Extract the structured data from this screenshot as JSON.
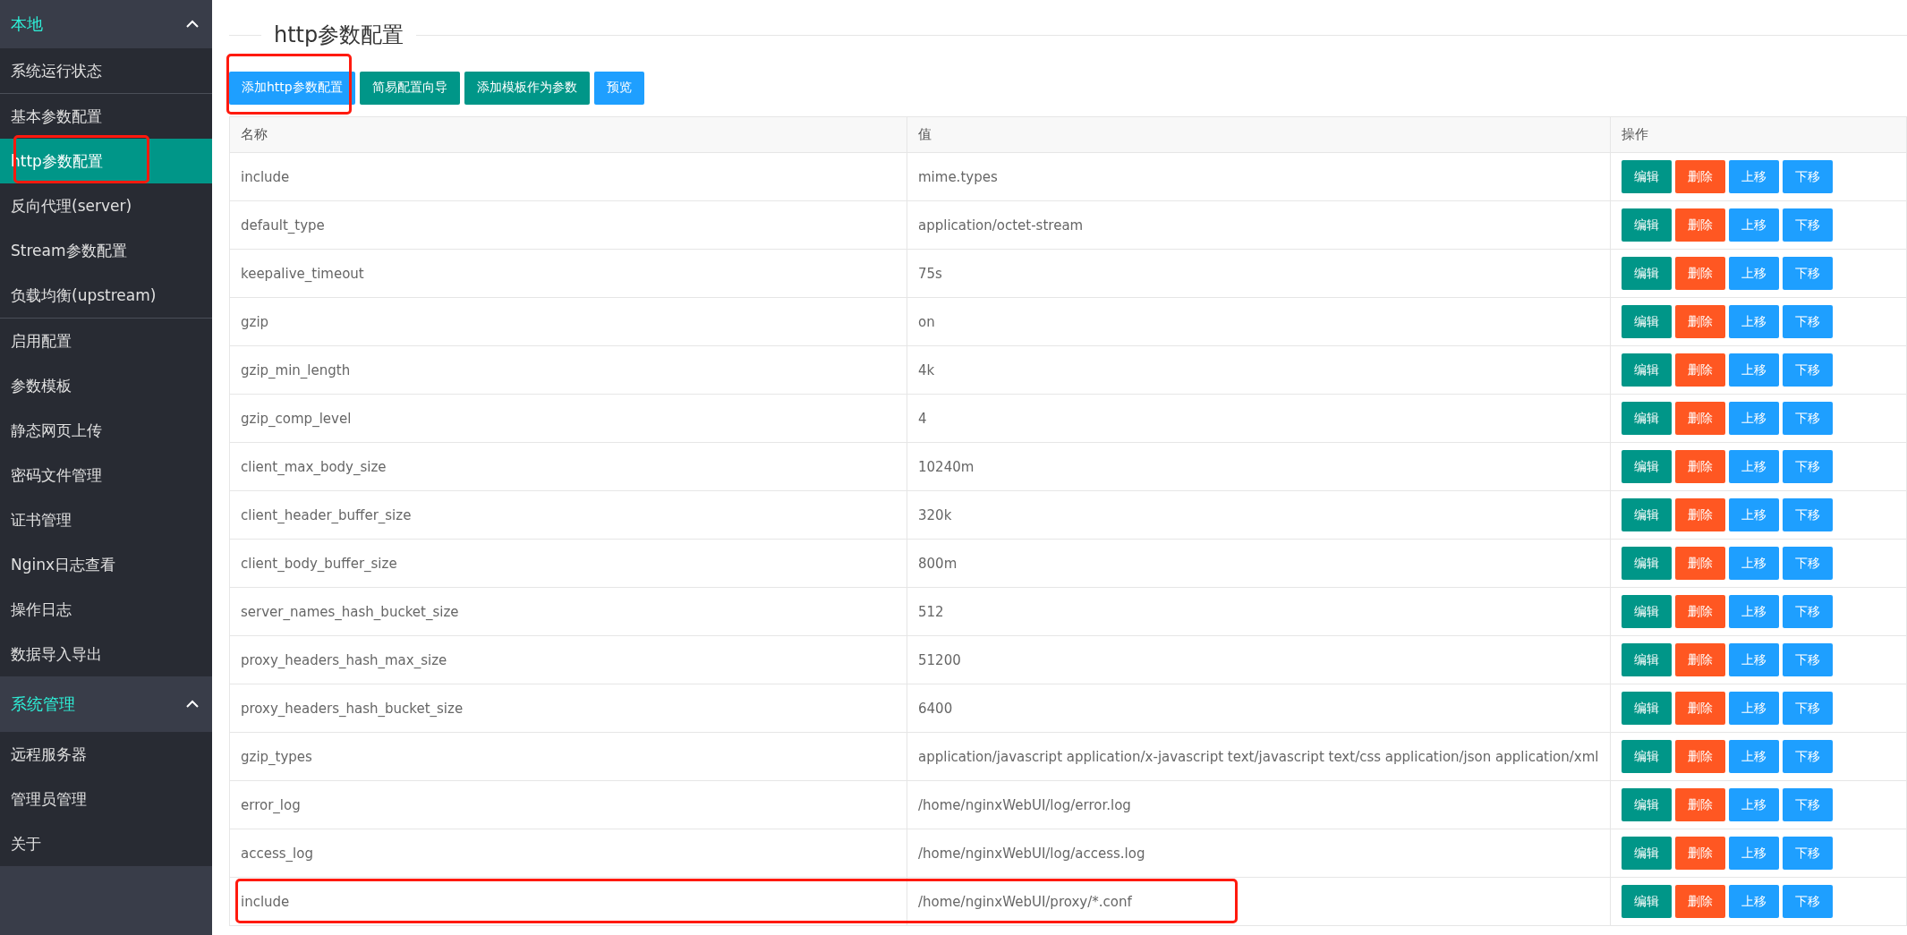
{
  "sidebar": {
    "groups": [
      {
        "title": "本地",
        "expanded": true,
        "sections": [
          [
            {
              "label": "系统运行状态",
              "selected": false,
              "highlighted": false
            }
          ],
          [
            {
              "label": "基本参数配置",
              "selected": false,
              "highlighted": false
            },
            {
              "label": "http参数配置",
              "selected": true,
              "highlighted": true
            },
            {
              "label": "反向代理(server)",
              "selected": false,
              "highlighted": false
            },
            {
              "label": "Stream参数配置",
              "selected": false,
              "highlighted": false
            },
            {
              "label": "负载均衡(upstream)",
              "selected": false,
              "highlighted": false
            }
          ],
          [
            {
              "label": "启用配置",
              "selected": false,
              "highlighted": false
            },
            {
              "label": "参数模板",
              "selected": false,
              "highlighted": false
            },
            {
              "label": "静态网页上传",
              "selected": false,
              "highlighted": false
            },
            {
              "label": "密码文件管理",
              "selected": false,
              "highlighted": false
            },
            {
              "label": "证书管理",
              "selected": false,
              "highlighted": false
            },
            {
              "label": "Nginx日志查看",
              "selected": false,
              "highlighted": false
            },
            {
              "label": "操作日志",
              "selected": false,
              "highlighted": false
            },
            {
              "label": "数据导入导出",
              "selected": false,
              "highlighted": false
            }
          ]
        ]
      },
      {
        "title": "系统管理",
        "expanded": true,
        "sections": [
          [
            {
              "label": "远程服务器",
              "selected": false,
              "highlighted": false
            },
            {
              "label": "管理员管理",
              "selected": false,
              "highlighted": false
            },
            {
              "label": "关于",
              "selected": false,
              "highlighted": false
            }
          ]
        ]
      }
    ]
  },
  "page_title": "http参数配置",
  "toolbar": [
    {
      "label": "添加http参数配置",
      "kind": "primary",
      "highlighted": true
    },
    {
      "label": "简易配置向导",
      "kind": "teal",
      "highlighted": false
    },
    {
      "label": "添加模板作为参数",
      "kind": "teal",
      "highlighted": false
    },
    {
      "label": "预览",
      "kind": "primary",
      "highlighted": false
    }
  ],
  "table": {
    "columns": [
      "名称",
      "值",
      "操作"
    ],
    "rows": [
      {
        "name": "include",
        "value": "mime.types",
        "highlighted": false,
        "actions": [
          {
            "label": "编辑",
            "kind": "teal"
          },
          {
            "label": "删除",
            "kind": "danger"
          },
          {
            "label": "上移",
            "kind": "primary"
          },
          {
            "label": "下移",
            "kind": "primary"
          }
        ]
      },
      {
        "name": "default_type",
        "value": "application/octet-stream",
        "highlighted": false,
        "actions": [
          {
            "label": "编辑",
            "kind": "teal"
          },
          {
            "label": "删除",
            "kind": "danger"
          },
          {
            "label": "上移",
            "kind": "primary"
          },
          {
            "label": "下移",
            "kind": "primary"
          }
        ]
      },
      {
        "name": "keepalive_timeout",
        "value": "75s",
        "highlighted": false,
        "actions": [
          {
            "label": "编辑",
            "kind": "teal"
          },
          {
            "label": "删除",
            "kind": "danger"
          },
          {
            "label": "上移",
            "kind": "primary"
          },
          {
            "label": "下移",
            "kind": "primary"
          }
        ]
      },
      {
        "name": "gzip",
        "value": "on",
        "highlighted": false,
        "actions": [
          {
            "label": "编辑",
            "kind": "teal"
          },
          {
            "label": "删除",
            "kind": "danger"
          },
          {
            "label": "上移",
            "kind": "primary"
          },
          {
            "label": "下移",
            "kind": "primary"
          }
        ]
      },
      {
        "name": "gzip_min_length",
        "value": "4k",
        "highlighted": false,
        "actions": [
          {
            "label": "编辑",
            "kind": "teal"
          },
          {
            "label": "删除",
            "kind": "danger"
          },
          {
            "label": "上移",
            "kind": "primary"
          },
          {
            "label": "下移",
            "kind": "primary"
          }
        ]
      },
      {
        "name": "gzip_comp_level",
        "value": "4",
        "highlighted": false,
        "actions": [
          {
            "label": "编辑",
            "kind": "teal"
          },
          {
            "label": "删除",
            "kind": "danger"
          },
          {
            "label": "上移",
            "kind": "primary"
          },
          {
            "label": "下移",
            "kind": "primary"
          }
        ]
      },
      {
        "name": "client_max_body_size",
        "value": "10240m",
        "highlighted": false,
        "actions": [
          {
            "label": "编辑",
            "kind": "teal"
          },
          {
            "label": "删除",
            "kind": "danger"
          },
          {
            "label": "上移",
            "kind": "primary"
          },
          {
            "label": "下移",
            "kind": "primary"
          }
        ]
      },
      {
        "name": "client_header_buffer_size",
        "value": "320k",
        "highlighted": false,
        "actions": [
          {
            "label": "编辑",
            "kind": "teal"
          },
          {
            "label": "删除",
            "kind": "danger"
          },
          {
            "label": "上移",
            "kind": "primary"
          },
          {
            "label": "下移",
            "kind": "primary"
          }
        ]
      },
      {
        "name": "client_body_buffer_size",
        "value": "800m",
        "highlighted": false,
        "actions": [
          {
            "label": "编辑",
            "kind": "teal"
          },
          {
            "label": "删除",
            "kind": "danger"
          },
          {
            "label": "上移",
            "kind": "primary"
          },
          {
            "label": "下移",
            "kind": "primary"
          }
        ]
      },
      {
        "name": "server_names_hash_bucket_size",
        "value": "512",
        "highlighted": false,
        "actions": [
          {
            "label": "编辑",
            "kind": "teal"
          },
          {
            "label": "删除",
            "kind": "danger"
          },
          {
            "label": "上移",
            "kind": "primary"
          },
          {
            "label": "下移",
            "kind": "primary"
          }
        ]
      },
      {
        "name": "proxy_headers_hash_max_size",
        "value": "51200",
        "highlighted": false,
        "actions": [
          {
            "label": "编辑",
            "kind": "teal"
          },
          {
            "label": "删除",
            "kind": "danger"
          },
          {
            "label": "上移",
            "kind": "primary"
          },
          {
            "label": "下移",
            "kind": "primary"
          }
        ]
      },
      {
        "name": "proxy_headers_hash_bucket_size",
        "value": "6400",
        "highlighted": false,
        "actions": [
          {
            "label": "编辑",
            "kind": "teal"
          },
          {
            "label": "删除",
            "kind": "danger"
          },
          {
            "label": "上移",
            "kind": "primary"
          },
          {
            "label": "下移",
            "kind": "primary"
          }
        ]
      },
      {
        "name": "gzip_types",
        "value": "application/javascript application/x-javascript text/javascript text/css application/json application/xml",
        "highlighted": false,
        "actions": [
          {
            "label": "编辑",
            "kind": "teal"
          },
          {
            "label": "删除",
            "kind": "danger"
          },
          {
            "label": "上移",
            "kind": "primary"
          },
          {
            "label": "下移",
            "kind": "primary"
          }
        ]
      },
      {
        "name": "error_log",
        "value": "/home/nginxWebUI/log/error.log",
        "highlighted": false,
        "actions": [
          {
            "label": "编辑",
            "kind": "teal"
          },
          {
            "label": "删除",
            "kind": "danger"
          },
          {
            "label": "上移",
            "kind": "primary"
          },
          {
            "label": "下移",
            "kind": "primary"
          }
        ]
      },
      {
        "name": "access_log",
        "value": "/home/nginxWebUI/log/access.log",
        "highlighted": false,
        "actions": [
          {
            "label": "编辑",
            "kind": "teal"
          },
          {
            "label": "删除",
            "kind": "danger"
          },
          {
            "label": "上移",
            "kind": "primary"
          },
          {
            "label": "下移",
            "kind": "primary"
          }
        ]
      },
      {
        "name": "include",
        "value": "/home/nginxWebUI/proxy/*.conf",
        "highlighted": true,
        "actions": [
          {
            "label": "编辑",
            "kind": "teal"
          },
          {
            "label": "删除",
            "kind": "danger"
          },
          {
            "label": "上移",
            "kind": "primary"
          },
          {
            "label": "下移",
            "kind": "primary"
          }
        ]
      }
    ]
  }
}
